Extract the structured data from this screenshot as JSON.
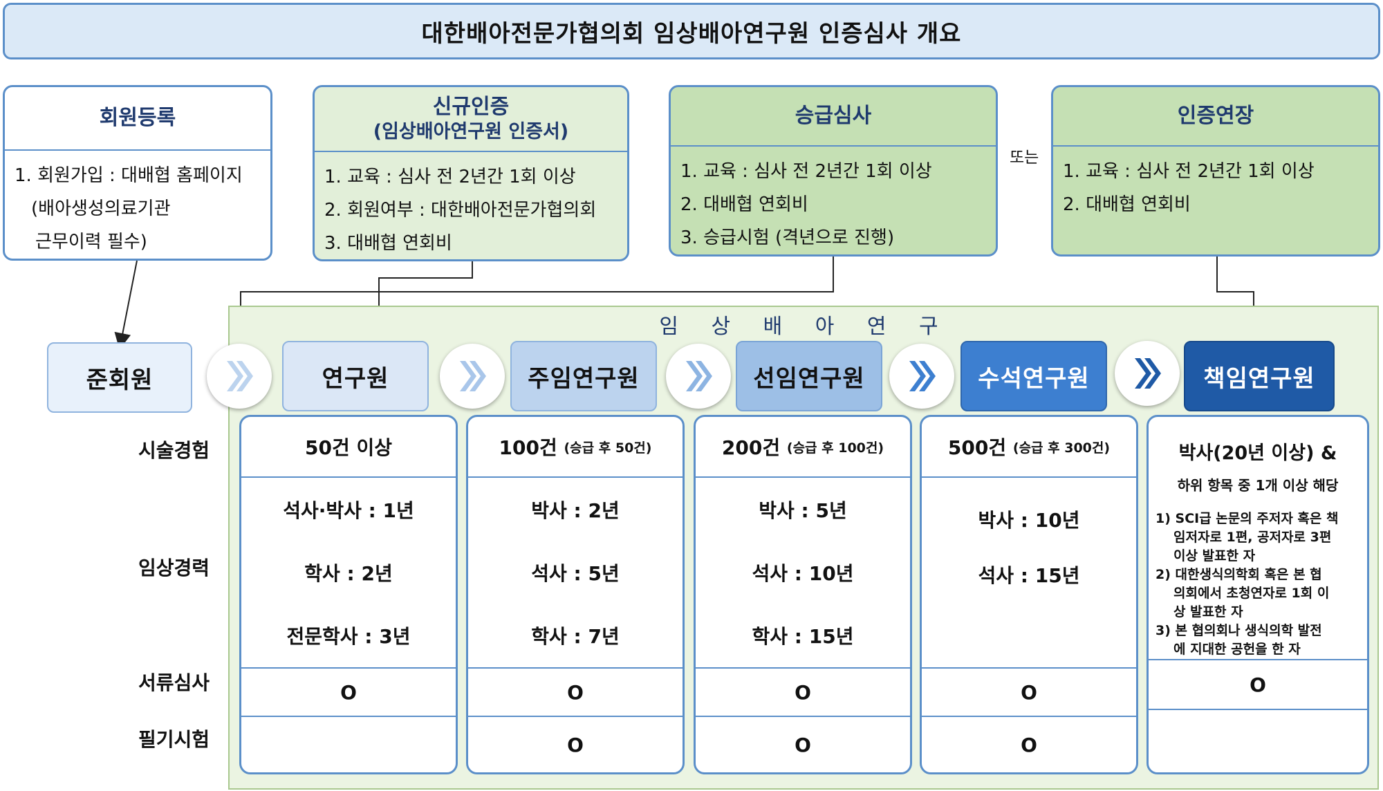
{
  "title": "대한배아전문가협의회 임상배아연구원 인증심사 개요",
  "top_boxes": {
    "member": {
      "title": "회원등록",
      "items": [
        "1. 회원가입 : 대배협 홈페이지",
        "(배아생성의료기관",
        "근무이력 필수)"
      ]
    },
    "new_cert": {
      "title": "신규인증",
      "subtitle": "(임상배아연구원 인증서)",
      "items": [
        "1. 교육 : 심사 전 2년간 1회 이상",
        "2. 회원여부 : 대한배아전문가협의회",
        "3. 대배협 연회비"
      ]
    },
    "promotion": {
      "title": "승급심사",
      "items": [
        "1. 교육 : 심사 전 2년간 1회 이상",
        "2. 대배협 연회비",
        "3. 승급시험 (격년으로 진행)"
      ]
    },
    "or_label": "또는",
    "extension": {
      "title": "인증연장",
      "items": [
        "1. 교육 : 심사 전 2년간 1회 이상",
        "2. 대배협 연회비"
      ]
    }
  },
  "panel_title": "임 상 배 아 연 구 원",
  "stages": [
    "준회원",
    "연구원",
    "주임연구원",
    "선임연구원",
    "수석연구원",
    "책임연구원"
  ],
  "row_labels": [
    "시술경험",
    "임상경력",
    "서류심사",
    "필기시험"
  ],
  "columns": [
    {
      "experience": "50건 이상",
      "experience_note": "",
      "career": [
        "석사·박사 : 1년",
        "학사 : 2년",
        "전문학사 : 3년"
      ],
      "document": "O",
      "written": ""
    },
    {
      "experience": "100건",
      "experience_note": "(승급 후 50건)",
      "career": [
        "박사 : 2년",
        "석사 : 5년",
        "학사 : 7년"
      ],
      "document": "O",
      "written": "O"
    },
    {
      "experience": "200건",
      "experience_note": "(승급 후 100건)",
      "career": [
        "박사 : 5년",
        "석사 : 10년",
        "학사 : 15년"
      ],
      "document": "O",
      "written": "O"
    },
    {
      "experience": "500건",
      "experience_note": "(승급 후 300건)",
      "career": [
        "박사 : 10년",
        "석사 : 15년"
      ],
      "document": "O",
      "written": "O"
    },
    {
      "experience": "박사(20년 이상) &",
      "experience_note": "하위 항목 중 1개 이상 해당",
      "career_lines": [
        "1) SCI급 논문의 주저자 혹은 책",
        "임저자로 1편, 공저자로 3편",
        "이상 발표한 자",
        "2) 대한생식의학회 혹은 본 협",
        "의회에서 초청연자로 1회 이",
        "상 발표한 자",
        "3) 본 협의회나 생식의학 발전",
        "에 지대한 공헌을 한 자"
      ],
      "document": "O",
      "written": ""
    }
  ],
  "colors": {
    "border_blue": "#5b8fc9",
    "title_bg": "#dbe9f7",
    "green_light": "#e2efd9",
    "green_mid": "#c5e0b4",
    "panel_bg": "#ebf4e2",
    "stage_0": "#e8f1fb",
    "stage_1": "#dbe7f6",
    "stage_2": "#bcd3ee",
    "stage_3": "#9dbfe6",
    "stage_4": "#3d7fd0",
    "stage_5": "#1f5aa6"
  },
  "icons": [
    "chevron-right-icon"
  ]
}
